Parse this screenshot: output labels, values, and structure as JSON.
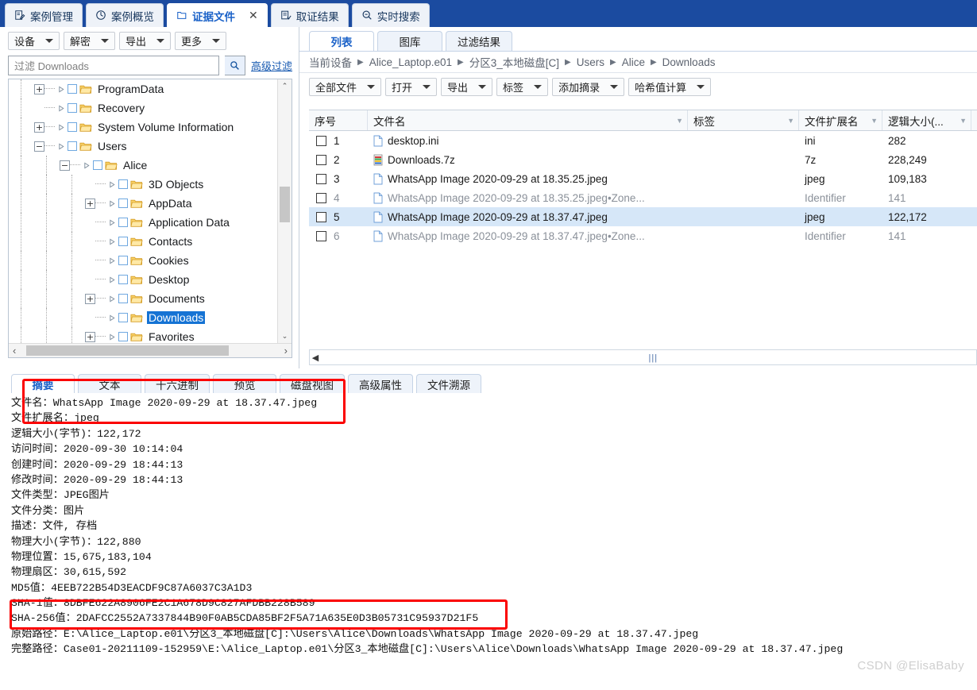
{
  "window": {
    "main_tabs": [
      {
        "label": "案例管理",
        "icon": "case-edit-icon",
        "active": false,
        "closable": false
      },
      {
        "label": "案例概览",
        "icon": "clock-chart-icon",
        "active": false,
        "closable": false
      },
      {
        "label": "证据文件",
        "icon": "folder-evidence-icon",
        "active": true,
        "closable": true
      },
      {
        "label": "取证结果",
        "icon": "list-check-icon",
        "active": false,
        "closable": false
      },
      {
        "label": "实时搜索",
        "icon": "search-minus-icon",
        "active": false,
        "closable": false
      }
    ],
    "close_label": "✕"
  },
  "left_panel": {
    "toolbar": [
      {
        "label": "设备"
      },
      {
        "label": "解密"
      },
      {
        "label": "导出"
      },
      {
        "label": "更多"
      }
    ],
    "filter": {
      "placeholder": "过滤 Downloads",
      "value": "",
      "search_icon": "search-icon",
      "advanced_label": "高级过滤"
    },
    "tree": [
      {
        "label": "ProgramData",
        "depth": 2,
        "expander": "+",
        "selected": false
      },
      {
        "label": "Recovery",
        "depth": 2,
        "expander": "",
        "selected": false
      },
      {
        "label": "System Volume Information",
        "depth": 2,
        "expander": "+",
        "selected": false
      },
      {
        "label": "Users",
        "depth": 2,
        "expander": "−",
        "selected": false
      },
      {
        "label": "Alice",
        "depth": 3,
        "expander": "−",
        "selected": false
      },
      {
        "label": "3D Objects",
        "depth": 4,
        "expander": "",
        "selected": false
      },
      {
        "label": "AppData",
        "depth": 4,
        "expander": "+",
        "selected": false
      },
      {
        "label": "Application Data",
        "depth": 4,
        "expander": "",
        "selected": false
      },
      {
        "label": "Contacts",
        "depth": 4,
        "expander": "",
        "selected": false
      },
      {
        "label": "Cookies",
        "depth": 4,
        "expander": "",
        "selected": false
      },
      {
        "label": "Desktop",
        "depth": 4,
        "expander": "",
        "selected": false
      },
      {
        "label": "Documents",
        "depth": 4,
        "expander": "+",
        "selected": false
      },
      {
        "label": "Downloads",
        "depth": 4,
        "expander": "",
        "selected": true
      },
      {
        "label": "Favorites",
        "depth": 4,
        "expander": "+",
        "selected": false
      }
    ],
    "scroll_up": "⌃",
    "scroll_down": "⌄",
    "scroll_left": "‹",
    "scroll_right": "›"
  },
  "right_panel": {
    "view_tabs": [
      {
        "label": "列表",
        "active": true
      },
      {
        "label": "图库",
        "active": false
      },
      {
        "label": "过滤结果",
        "active": false
      }
    ],
    "breadcrumb": [
      "当前设备",
      "Alice_Laptop.e01",
      "分区3_本地磁盘[C]",
      "Users",
      "Alice",
      "Downloads"
    ],
    "breadcrumb_sep": "▶",
    "toolbar": [
      {
        "label": "全部文件"
      },
      {
        "label": "打开"
      },
      {
        "label": "导出"
      },
      {
        "label": "标签"
      },
      {
        "label": "添加摘录"
      },
      {
        "label": "哈希值计算"
      }
    ],
    "columns": [
      {
        "key": "seq",
        "label": "序号",
        "filter": false
      },
      {
        "key": "name",
        "label": "文件名",
        "filter": true
      },
      {
        "key": "tag",
        "label": "标签",
        "filter": true
      },
      {
        "key": "ext",
        "label": "文件扩展名",
        "filter": true
      },
      {
        "key": "size",
        "label": "逻辑大小(...",
        "filter": true
      }
    ],
    "rows": [
      {
        "seq": "1",
        "name": "desktop.ini",
        "tag": "",
        "ext": "ini",
        "size": "282",
        "selected": false,
        "dim": false,
        "icon": "file-icon"
      },
      {
        "seq": "2",
        "name": "Downloads.7z",
        "tag": "",
        "ext": "7z",
        "size": "228,249",
        "selected": false,
        "dim": false,
        "icon": "archive-icon"
      },
      {
        "seq": "3",
        "name": "WhatsApp Image 2020-09-29 at 18.35.25.jpeg",
        "tag": "",
        "ext": "jpeg",
        "size": "109,183",
        "selected": false,
        "dim": false,
        "icon": "file-icon"
      },
      {
        "seq": "4",
        "name": "WhatsApp Image 2020-09-29 at 18.35.25.jpeg•Zone...",
        "tag": "",
        "ext": "Identifier",
        "size": "141",
        "selected": false,
        "dim": true,
        "icon": "file-icon"
      },
      {
        "seq": "5",
        "name": "WhatsApp Image 2020-09-29 at 18.37.47.jpeg",
        "tag": "",
        "ext": "jpeg",
        "size": "122,172",
        "selected": true,
        "dim": false,
        "icon": "file-icon"
      },
      {
        "seq": "6",
        "name": "WhatsApp Image 2020-09-29 at 18.37.47.jpeg•Zone...",
        "tag": "",
        "ext": "Identifier",
        "size": "141",
        "selected": false,
        "dim": true,
        "icon": "file-icon"
      }
    ],
    "hscroll_left_arrow": "◀",
    "hscroll_grip": "|||"
  },
  "detail_panel": {
    "tabs": [
      {
        "label": "摘要",
        "active": true
      },
      {
        "label": "文本",
        "active": false
      },
      {
        "label": "十六进制",
        "active": false
      },
      {
        "label": "预览",
        "active": false
      },
      {
        "label": "磁盘视图",
        "active": false
      },
      {
        "label": "高级属性",
        "active": false
      },
      {
        "label": "文件溯源",
        "active": false
      }
    ],
    "lines": [
      "文件名：WhatsApp Image 2020-09-29 at 18.37.47.jpeg",
      "文件扩展名：jpeg",
      "逻辑大小(字节)：122,172",
      "访问时间：2020-09-30 10:14:04",
      "创建时间：2020-09-29 18:44:13",
      "修改时间：2020-09-29 18:44:13",
      "文件类型：JPEG图片",
      "文件分类：图片",
      "描述：文件, 存档",
      "物理大小(字节)：122,880",
      "物理位置：15,675,183,104",
      "物理扇区：30,615,592",
      "MD5值：4EEB722B54D3EACDF9C87A6037C3A1D3",
      "SHA-1值：8DBFE622A8906FE2C1A678D9C827AFDBB228B589",
      "SHA-256值：2DAFCC2552A7337844B90F0AB5CDA85BF2F5A71A635E0D3B05731C95937D21F5",
      "原始路径：E:\\Alice_Laptop.e01\\分区3_本地磁盘[C]:\\Users\\Alice\\Downloads\\WhatsApp Image 2020-09-29 at 18.37.47.jpeg",
      "完整路径：Case01-20211109-152959\\E:\\Alice_Laptop.e01\\分区3_本地磁盘[C]:\\Users\\Alice\\Downloads\\WhatsApp Image 2020-09-29 at 18.37.47.jpeg"
    ]
  },
  "annotations": {
    "highlight_color": "#fb0000",
    "boxes": [
      "summary-tabs-and-filename",
      "sha256-and-original-path"
    ]
  },
  "watermark": "CSDN @ElisaBaby",
  "colors": {
    "title_bar": "#1b4ba0",
    "active_tab_text": "#1b62c8",
    "selection": "#d6e7f8",
    "tree_selection": "#1573d4",
    "annotation": "#fb0000"
  }
}
